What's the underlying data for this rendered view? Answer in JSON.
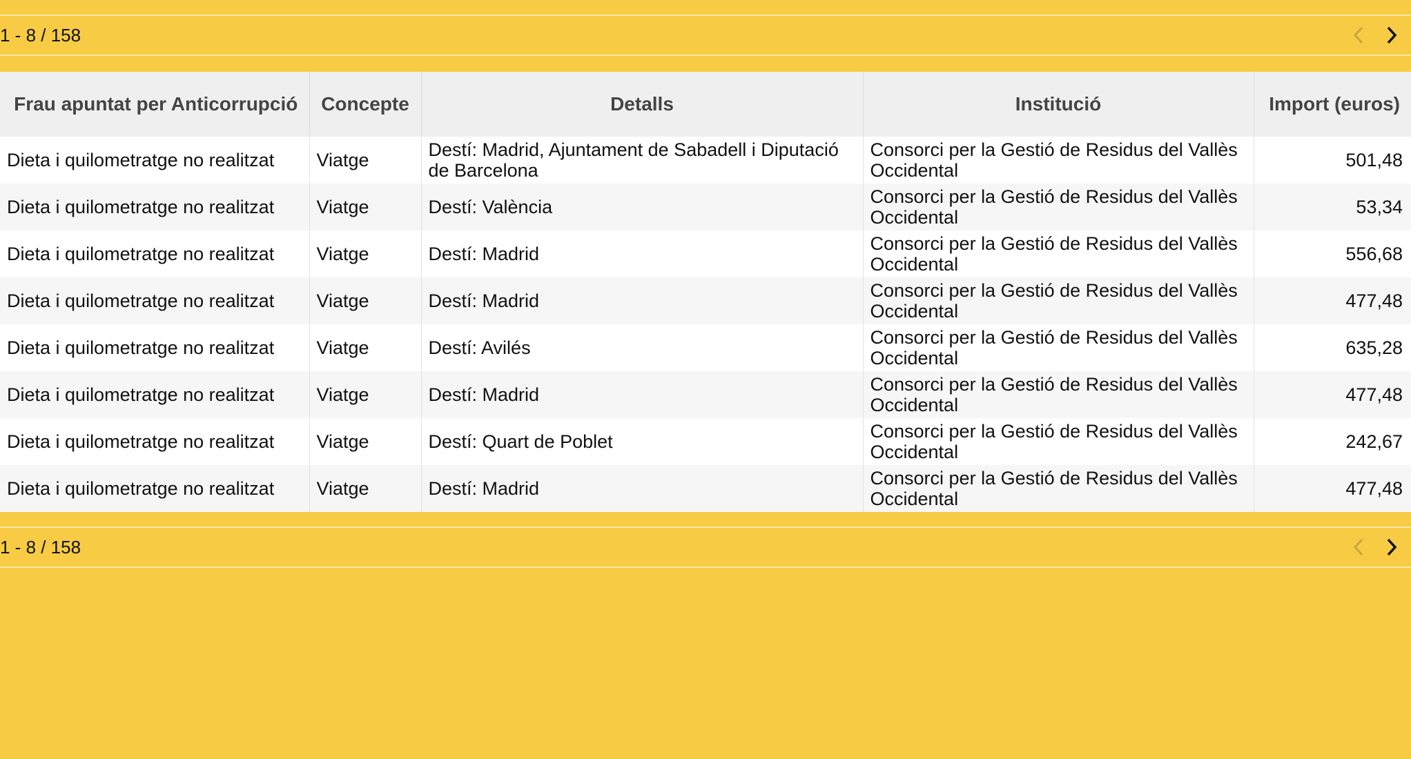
{
  "pagination": {
    "range_label": "1 - 8 / 158",
    "prev_icon": "chevron-left-icon",
    "next_icon": "chevron-right-icon"
  },
  "table": {
    "headers": [
      "Frau apuntat per Anticorrupció",
      "Concepte",
      "Detalls",
      "Institució",
      "Import (euros)"
    ],
    "rows": [
      [
        "Dieta i quilometratge no realitzat",
        "Viatge",
        "Destí: Madrid, Ajuntament de Sabadell i Diputació de Barcelona",
        "Consorci per la Gestió de Residus del Vallès Occidental",
        "501,48"
      ],
      [
        "Dieta i quilometratge no realitzat",
        "Viatge",
        "Destí: València",
        "Consorci per la Gestió de Residus del Vallès Occidental",
        "53,34"
      ],
      [
        "Dieta i quilometratge no realitzat",
        "Viatge",
        "Destí: Madrid",
        "Consorci per la Gestió de Residus del Vallès Occidental",
        "556,68"
      ],
      [
        "Dieta i quilometratge no realitzat",
        "Viatge",
        "Destí: Madrid",
        "Consorci per la Gestió de Residus del Vallès Occidental",
        "477,48"
      ],
      [
        "Dieta i quilometratge no realitzat",
        "Viatge",
        "Destí: Avilés",
        "Consorci per la Gestió de Residus del Vallès Occidental",
        "635,28"
      ],
      [
        "Dieta i quilometratge no realitzat",
        "Viatge",
        "Destí: Madrid",
        "Consorci per la Gestió de Residus del Vallès Occidental",
        "477,48"
      ],
      [
        "Dieta i quilometratge no realitzat",
        "Viatge",
        "Destí: Quart de Poblet",
        "Consorci per la Gestió de Residus del Vallès Occidental",
        "242,67"
      ],
      [
        "Dieta i quilometratge no realitzat",
        "Viatge",
        "Destí: Madrid",
        "Consorci per la Gestió de Residus del Vallès Occidental",
        "477,48"
      ]
    ]
  },
  "colors": {
    "background": "#f7cb43",
    "header_bg": "#efefef",
    "row_alt_bg": "#f6f6f6"
  }
}
